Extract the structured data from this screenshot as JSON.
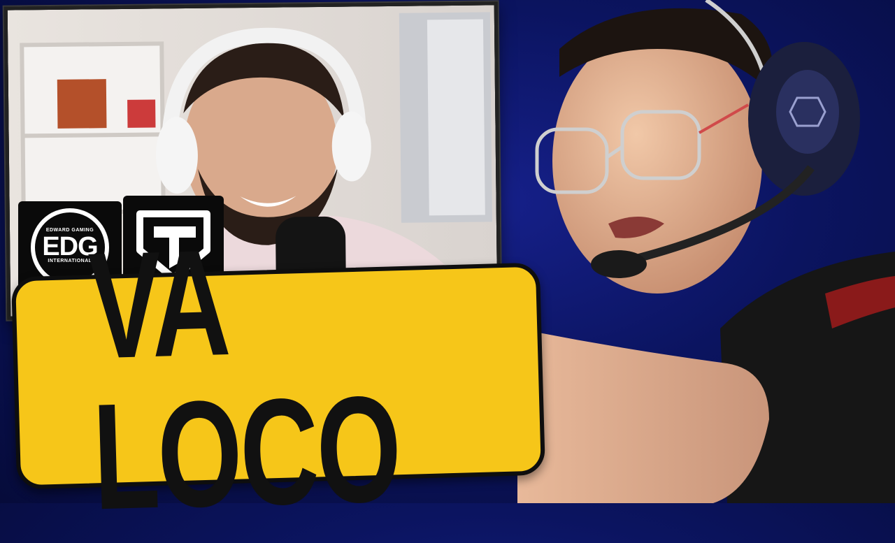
{
  "title": {
    "text": "VA LOCO"
  },
  "logos": {
    "edg": {
      "top_text": "EDWARD GAMING",
      "main_text": "EDG",
      "bottom_text": "INTERNATIONAL"
    },
    "second_team_icon": "shield-chevron-logo"
  },
  "colors": {
    "background": "#0b1460",
    "banner": "#f6c619",
    "banner_text": "#111111"
  }
}
